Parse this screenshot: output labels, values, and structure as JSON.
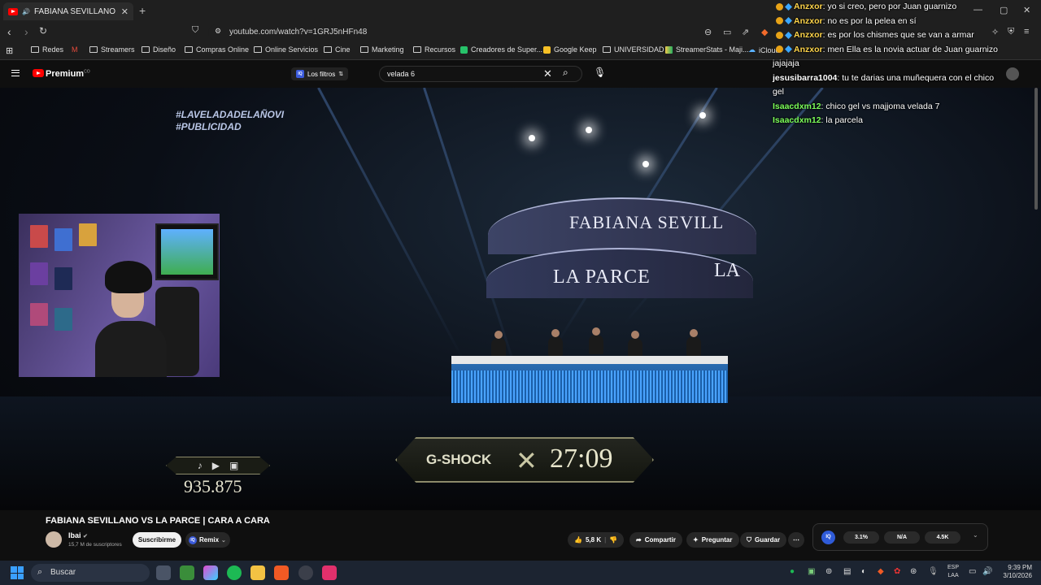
{
  "browser": {
    "tab_title": "FABIANA SEVILLANO VS LA P",
    "url": "youtube.com/watch?v=1GRJ5nHFn48",
    "bookmarks": [
      "Redes",
      "Streamers",
      "Diseño",
      "Compras Online",
      "Online Servicios",
      "Cine",
      "Marketing",
      "Recursos",
      "Creadores de Super...",
      "Google Keep",
      "UNIVERSIDAD",
      "StreamerStats - Maji...",
      "iCloud"
    ]
  },
  "youtube": {
    "brand": "Premium",
    "brand_sup": "CO",
    "filter_chip": "Los filtros",
    "search_value": "velada 6"
  },
  "video": {
    "hashtags": [
      "#LAVELADADELAÑOVI",
      "#PUBLICIDAD"
    ],
    "arc_line1": "FABIANA SEVILL",
    "arc_line2": "LA PARCE",
    "arc_line2b": "LA",
    "sponsor": "G-SHOCK",
    "countdown": "27:09",
    "viewer_count": "935.875"
  },
  "chat": [
    {
      "user": "Anzxor",
      "msg": "yo si creo, pero por Juan guarnizo",
      "color": "#ffd54a",
      "badges": true
    },
    {
      "user": "Anzxor",
      "msg": "no es por la pelea en sí",
      "color": "#ffd54a",
      "badges": true
    },
    {
      "user": "Anzxor",
      "msg": "es por los chismes que se van a armar",
      "color": "#ffd54a",
      "badges": true
    },
    {
      "user": "Anzxor",
      "msg": "men Ella es la novia actuar de Juan guarnizo jajajaja",
      "color": "#ffd54a",
      "badges": true
    },
    {
      "user": "jesusibarra1004",
      "msg": "tu te darias una muñequera con el chico gel",
      "color": "#ffffff",
      "badges": false
    },
    {
      "user": "Isaacdxm12",
      "msg": "chico gel vs majjoma velada 7",
      "color": "#7cff5a",
      "badges": false
    },
    {
      "user": "Isaacdxm12",
      "msg": "la parcela",
      "color": "#7cff5a",
      "badges": false
    }
  ],
  "details": {
    "title": "FABIANA SEVILLANO VS LA PARCE | CARA A CARA",
    "channel": "Ibai",
    "subscribers": "15,7 M de suscriptores",
    "subscribe_label": "Suscribirme",
    "remix_label": "Remix",
    "likes": "5,8 K",
    "share_label": "Compartir",
    "ask_label": "Preguntar",
    "save_label": "Guardar",
    "iq_label": "IQ",
    "stats": [
      "3.1%",
      "N/A",
      "4.5K"
    ]
  },
  "taskbar": {
    "search_placeholder": "Buscar",
    "lang_top": "ESP",
    "lang_bottom": "LAA",
    "time": "9:39 PM",
    "date": "3/10/2026"
  }
}
